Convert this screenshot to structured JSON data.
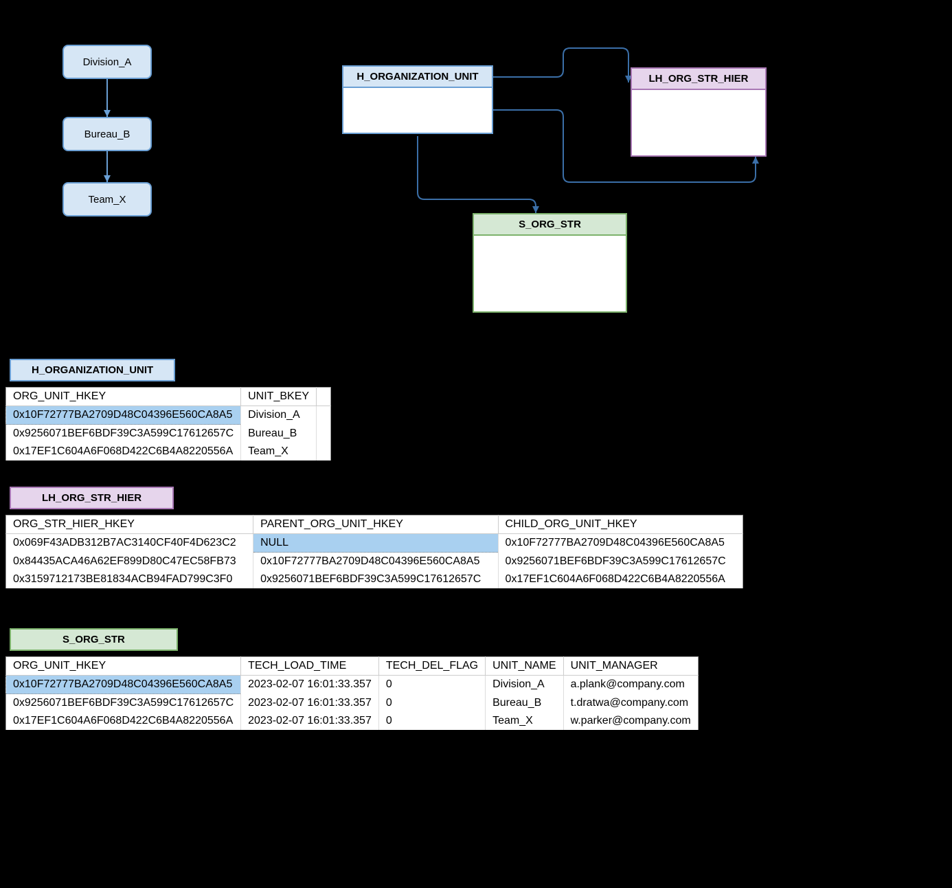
{
  "nodes": {
    "divA": "Division_A",
    "burB": "Bureau_B",
    "teamX": "Team_X"
  },
  "entities": {
    "h_org": "H_ORGANIZATION_UNIT",
    "lh_org": "LH_ORG_STR_HIER",
    "s_org": "S_ORG_STR"
  },
  "table_h_org": {
    "headers": [
      "ORG_UNIT_HKEY",
      "UNIT_BKEY"
    ],
    "rows": [
      [
        "0x10F72777BA2709D48C04396E560CA8A5",
        "Division_A"
      ],
      [
        "0x9256071BEF6BDF39C3A599C17612657C",
        "Bureau_B"
      ],
      [
        "0x17EF1C604A6F068D422C6B4A8220556A",
        "Team_X"
      ]
    ]
  },
  "table_lh_org": {
    "headers": [
      "ORG_STR_HIER_HKEY",
      "PARENT_ORG_UNIT_HKEY",
      "CHILD_ORG_UNIT_HKEY"
    ],
    "rows": [
      [
        "0x069F43ADB312B7AC3140CF40F4D623C2",
        "NULL",
        "0x10F72777BA2709D48C04396E560CA8A5"
      ],
      [
        "0x84435ACA46A62EF899D80C47EC58FB73",
        "0x10F72777BA2709D48C04396E560CA8A5",
        "0x9256071BEF6BDF39C3A599C17612657C"
      ],
      [
        "0x3159712173BE81834ACB94FAD799C3F0",
        "0x9256071BEF6BDF39C3A599C17612657C",
        "0x17EF1C604A6F068D422C6B4A8220556A"
      ]
    ]
  },
  "table_s_org": {
    "headers": [
      "ORG_UNIT_HKEY",
      "TECH_LOAD_TIME",
      "TECH_DEL_FLAG",
      "UNIT_NAME",
      "UNIT_MANAGER"
    ],
    "rows": [
      [
        "0x10F72777BA2709D48C04396E560CA8A5",
        "2023-02-07 16:01:33.357",
        "0",
        "Division_A",
        "a.plank@company.com"
      ],
      [
        "0x9256071BEF6BDF39C3A599C17612657C",
        "2023-02-07 16:01:33.357",
        "0",
        "Bureau_B",
        "t.dratwa@company.com"
      ],
      [
        "0x17EF1C604A6F068D422C6B4A8220556A",
        "2023-02-07 16:01:33.357",
        "0",
        "Team_X",
        "w.parker@company.com"
      ]
    ]
  }
}
